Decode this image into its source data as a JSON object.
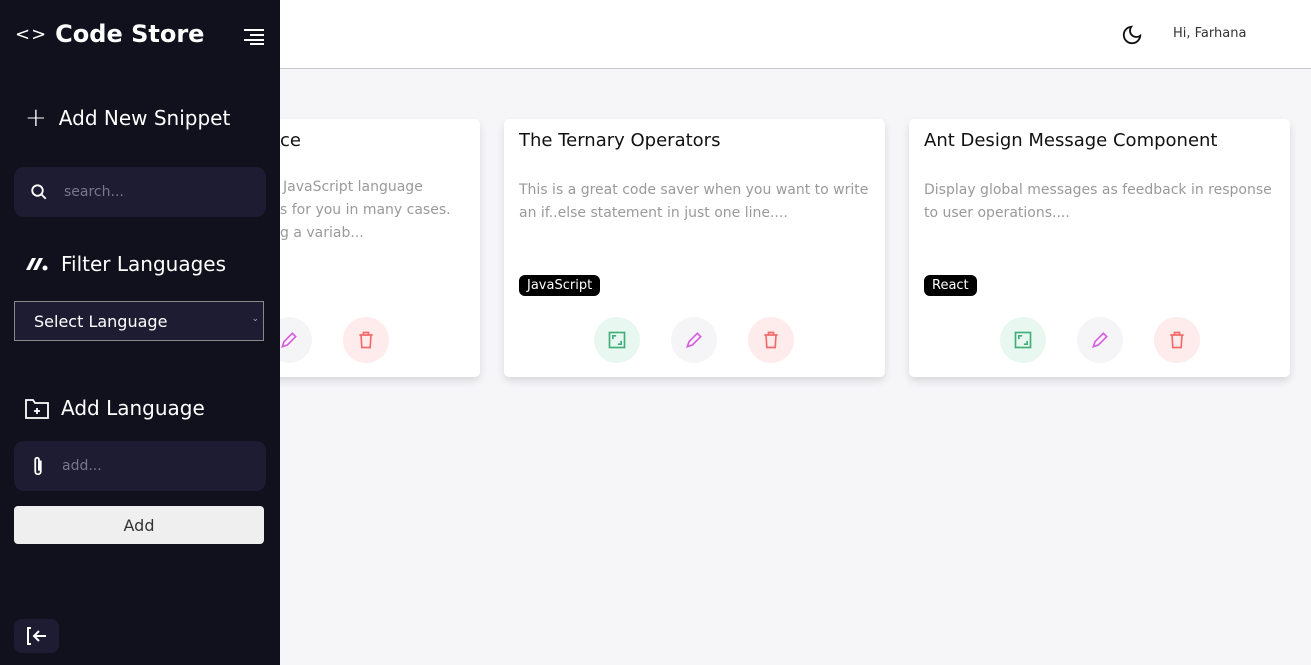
{
  "sidebar": {
    "title": "Code Store",
    "add_snippet": "Add New Snippet",
    "search_placeholder": "search...",
    "filter_label": "Filter Languages",
    "select_value": "Select Language",
    "add_language_label": "Add Language",
    "add_placeholder": "add...",
    "add_button": "Add"
  },
  "header": {
    "greeting": "Hi, Farhana"
  },
  "cards": [
    {
      "title_fragment": "ce",
      "desc_fragments": [
        "JavaScript language",
        "s for you in many cases.",
        "g a variab..."
      ]
    },
    {
      "title": "The Ternary Operators",
      "desc": "This is a great code saver when you want to write an if..else statement in just one line....",
      "tag": "JavaScript"
    },
    {
      "title": "Ant Design Message Component",
      "desc": "Display global messages as feedback in response to user operations....",
      "tag": "React"
    }
  ],
  "colors": {
    "sidebar": "#11111d",
    "field": "#1d1c33",
    "view": "#3fae7a",
    "edit": "#d65ee0",
    "delete": "#f26b6b"
  }
}
